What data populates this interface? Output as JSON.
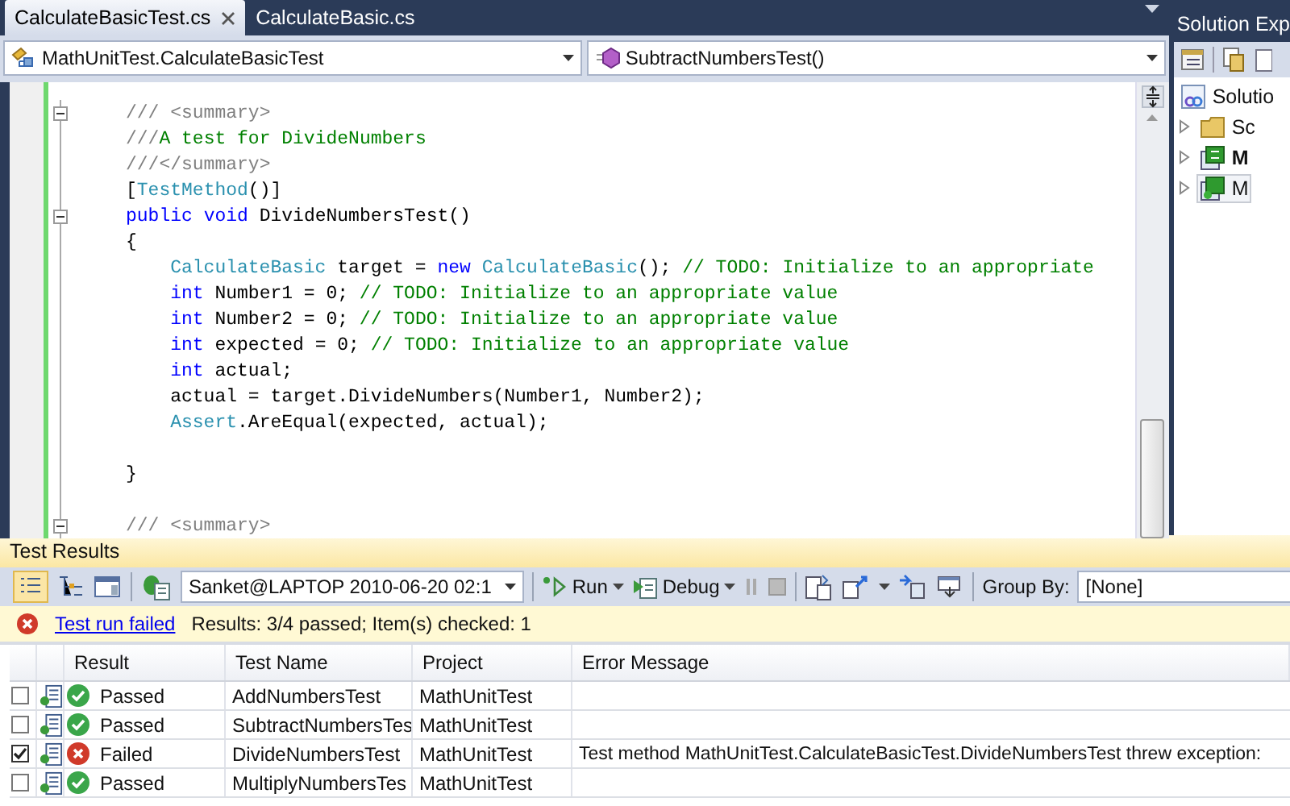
{
  "editor": {
    "tabs": [
      {
        "label": "CalculateBasicTest.cs",
        "selected": true
      },
      {
        "label": "CalculateBasic.cs",
        "selected": false
      }
    ],
    "type_dropdown": {
      "value": "MathUnitTest.CalculateBasicTest"
    },
    "member_dropdown": {
      "value": "SubtractNumbersTest()"
    },
    "code_lines": [
      {
        "kind": "code",
        "fold": true,
        "tokens": [
          {
            "kind": "doc",
            "text": "/// <summary>"
          }
        ]
      },
      {
        "kind": "code",
        "tokens": [
          {
            "kind": "doc",
            "text": "///"
          },
          {
            "kind": "comment",
            "text": "A test for DivideNumbers"
          }
        ]
      },
      {
        "kind": "code",
        "tokens": [
          {
            "kind": "doc",
            "text": "///</summary>"
          }
        ]
      },
      {
        "kind": "code",
        "tokens": [
          {
            "kind": "plain",
            "text": "["
          },
          {
            "kind": "type",
            "text": "TestMethod"
          },
          {
            "kind": "plain",
            "text": "()]"
          }
        ]
      },
      {
        "kind": "code",
        "fold": true,
        "tokens": [
          {
            "kind": "keyword",
            "text": "public"
          },
          {
            "kind": "keyword",
            "text": " void"
          },
          {
            "kind": "plain",
            "text": " DivideNumbersTest()"
          }
        ]
      },
      {
        "kind": "code",
        "tokens": [
          {
            "kind": "plain",
            "text": "{"
          }
        ],
        "children": [
          {
            "kind": "code",
            "tokens": [
              {
                "kind": "type",
                "text": "CalculateBasic"
              },
              {
                "kind": "plain",
                "text": " target = "
              },
              {
                "kind": "keyword",
                "text": "new"
              },
              {
                "kind": "type",
                "text": " CalculateBasic"
              },
              {
                "kind": "plain",
                "text": "();"
              },
              {
                "kind": "comment",
                "text": " // TODO: Initialize to an appropriate"
              }
            ]
          },
          {
            "kind": "code",
            "tokens": [
              {
                "kind": "keyword",
                "text": "int"
              },
              {
                "kind": "plain",
                "text": " Number1 = 0;"
              },
              {
                "kind": "comment",
                "text": " // TODO: Initialize to an appropriate value"
              }
            ]
          },
          {
            "kind": "code",
            "tokens": [
              {
                "kind": "keyword",
                "text": "int"
              },
              {
                "kind": "plain",
                "text": " Number2 = 0;"
              },
              {
                "kind": "comment",
                "text": " // TODO: Initialize to an appropriate value"
              }
            ]
          },
          {
            "kind": "code",
            "tokens": [
              {
                "kind": "keyword",
                "text": "int"
              },
              {
                "kind": "plain",
                "text": " expected = 0;"
              },
              {
                "kind": "comment",
                "text": " // TODO: Initialize to an appropriate value"
              }
            ]
          },
          {
            "kind": "code",
            "tokens": [
              {
                "kind": "keyword",
                "text": "int"
              },
              {
                "kind": "plain",
                "text": " actual;"
              }
            ]
          },
          {
            "kind": "code",
            "tokens": [
              {
                "kind": "plain",
                "text": "actual = target.DivideNumbers(Number1, Number2);"
              }
            ]
          },
          {
            "kind": "code",
            "tokens": [
              {
                "kind": "type",
                "text": "Assert"
              },
              {
                "kind": "plain",
                "text": ".AreEqual(expected, actual);"
              }
            ]
          },
          {
            "kind": "blank"
          }
        ]
      },
      {
        "kind": "code",
        "tokens": [
          {
            "kind": "plain",
            "text": "}"
          }
        ]
      },
      {
        "kind": "blank"
      },
      {
        "kind": "code",
        "fold": true,
        "tokens": [
          {
            "kind": "doc",
            "text": "/// <summary>"
          }
        ]
      }
    ]
  },
  "solution_explorer": {
    "title": "Solution Exp",
    "items": [
      {
        "label": "Solutio",
        "kind": "solution",
        "children": [
          {
            "label": "Sc",
            "kind": "folder",
            "startup": false,
            "selected": false
          },
          {
            "label": "M",
            "kind": "project",
            "startup": true,
            "selected": false
          },
          {
            "label": "M",
            "kind": "test-project",
            "startup": false,
            "selected": true
          }
        ]
      }
    ]
  },
  "test_results": {
    "title": "Test Results",
    "run_dropdown": {
      "value": "Sanket@LAPTOP 2010-06-20 02:1"
    },
    "run_button": "Run",
    "debug_button": "Debug",
    "group_by_label": "Group By:",
    "group_by_dropdown": {
      "value": "[None]"
    },
    "status": {
      "link": "Test run failed",
      "summary": "Results: 3/4 passed;  Item(s) checked: 1"
    },
    "table": {
      "columns": [
        "Result",
        "Test Name",
        "Project",
        "Error Message"
      ],
      "rows": [
        {
          "checked": false,
          "kind": "passed",
          "result": "Passed",
          "test_name": "AddNumbersTest",
          "project": "MathUnitTest"
        },
        {
          "checked": false,
          "kind": "passed",
          "result": "Passed",
          "test_name": "SubtractNumbersTes",
          "project": "MathUnitTest"
        },
        {
          "checked": true,
          "kind": "failed",
          "result": "Failed",
          "test_name": "DivideNumbersTest",
          "project": "MathUnitTest",
          "error": "Test method MathUnitTest.CalculateBasicTest.DivideNumbersTest threw exception:"
        },
        {
          "checked": false,
          "kind": "passed",
          "result": "Passed",
          "test_name": "MultiplyNumbersTes",
          "project": "MathUnitTest"
        }
      ]
    }
  }
}
